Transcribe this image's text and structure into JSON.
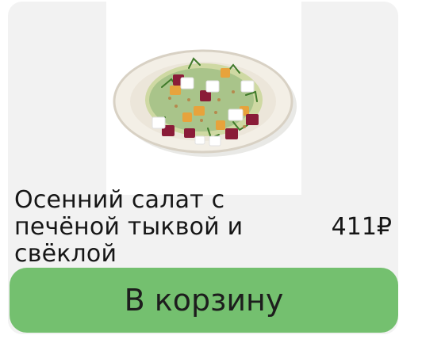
{
  "product": {
    "image_alt": "salad-bowl",
    "title": "Осенний салат с печёной тыквой и свёклой",
    "price": "411₽"
  },
  "actions": {
    "add_to_cart_label": "В корзину"
  },
  "colors": {
    "card_bg": "#f2f2f2",
    "button_bg": "#74c06f",
    "text": "#161616"
  }
}
